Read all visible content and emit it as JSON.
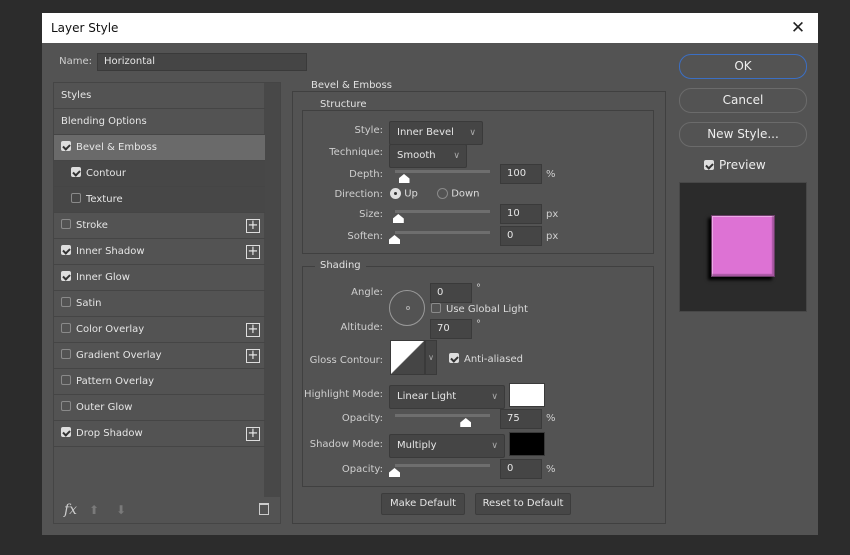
{
  "title": "Layer Style",
  "name_label": "Name:",
  "name_value": "Horizontal",
  "styles_list": [
    {
      "label": "Styles"
    },
    {
      "label": "Blending Options"
    },
    {
      "label": "Bevel & Emboss",
      "checked": true,
      "selected": true
    },
    {
      "label": "Contour",
      "checked": true
    },
    {
      "label": "Texture",
      "checked": false
    },
    {
      "label": "Stroke",
      "checked": false,
      "plus": true
    },
    {
      "label": "Inner Shadow",
      "checked": true,
      "plus": true
    },
    {
      "label": "Inner Glow",
      "checked": true
    },
    {
      "label": "Satin",
      "checked": false
    },
    {
      "label": "Color Overlay",
      "checked": false,
      "plus": true
    },
    {
      "label": "Gradient Overlay",
      "checked": false,
      "plus": true
    },
    {
      "label": "Pattern Overlay",
      "checked": false
    },
    {
      "label": "Outer Glow",
      "checked": false
    },
    {
      "label": "Drop Shadow",
      "checked": true,
      "plus": true
    }
  ],
  "list_footer": {
    "fx": "fx",
    "up": "up-arrow",
    "down": "down-arrow",
    "delete": "trash"
  },
  "bevel": {
    "title": "Bevel & Emboss",
    "structure": {
      "title": "Structure",
      "style_label": "Style:",
      "style_value": "Inner Bevel",
      "technique_label": "Technique:",
      "technique_value": "Smooth",
      "depth_label": "Depth:",
      "depth_value": "100",
      "depth_unit": "%",
      "depth_fraction": 0.1,
      "direction_label": "Direction:",
      "direction_up": "Up",
      "direction_down": "Down",
      "direction_selected": "Up",
      "size_label": "Size:",
      "size_value": "10",
      "size_unit": "px",
      "size_fraction": 0.04,
      "soften_label": "Soften:",
      "soften_value": "0",
      "soften_unit": "px",
      "soften_fraction": 0
    },
    "shading": {
      "title": "Shading",
      "angle_label": "Angle:",
      "angle_value": "0",
      "angle_unit": "°",
      "global_light_label": "Use Global Light",
      "global_light_checked": false,
      "altitude_label": "Altitude:",
      "altitude_value": "70",
      "altitude_unit": "°",
      "gloss_label": "Gloss Contour:",
      "antialiased_label": "Anti-aliased",
      "antialiased_checked": true,
      "highlight_label": "Highlight Mode:",
      "highlight_value": "Linear Light",
      "highlight_color": "#ffffff",
      "highlight_opacity_label": "Opacity:",
      "highlight_opacity_value": "75",
      "highlight_opacity_unit": "%",
      "shadow_label": "Shadow Mode:",
      "shadow_value": "Multiply",
      "shadow_color": "#000000",
      "shadow_opacity_label": "Opacity:",
      "shadow_opacity_value": "0",
      "shadow_opacity_unit": "%"
    },
    "make_default": "Make Default",
    "reset_default": "Reset to Default"
  },
  "buttons": {
    "ok": "OK",
    "cancel": "Cancel",
    "new_style": "New Style..."
  },
  "preview_label": "Preview",
  "preview_checked": true,
  "preview_color": "#dd72d4"
}
